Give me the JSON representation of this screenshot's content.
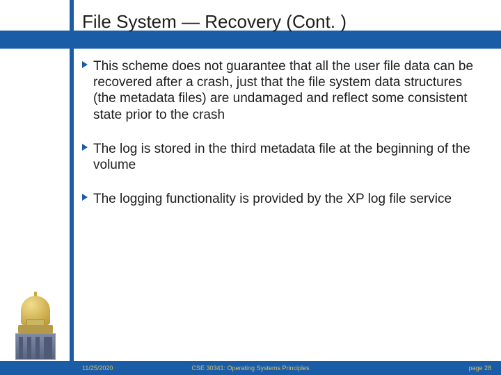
{
  "title": "File System — Recovery (Cont. )",
  "bullets": [
    "This scheme does not guarantee that all the user file data can be recovered after a crash, just that the file system data structures (the metadata files) are undamaged and reflect some consistent state prior to the crash",
    "The log is stored in the third metadata file at the beginning of the volume",
    "The logging functionality is provided by the XP log file service"
  ],
  "footer": {
    "date": "11/25/2020",
    "course": "CSE 30341: Operating Systems Principles",
    "page": "page 28"
  }
}
